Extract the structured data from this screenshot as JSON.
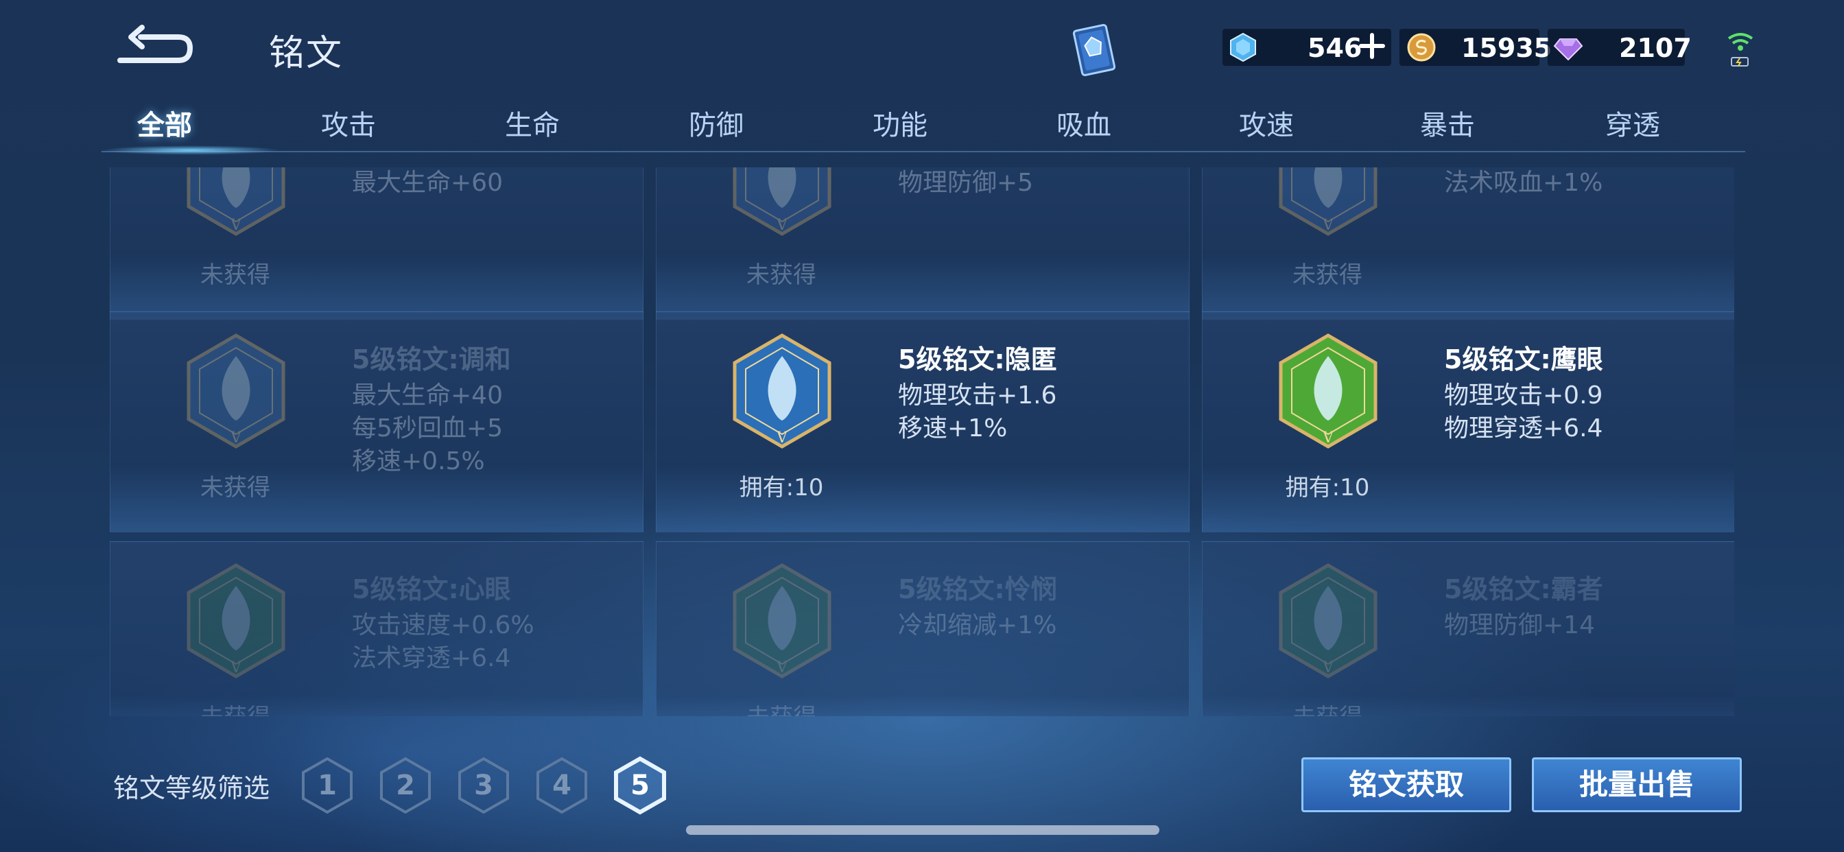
{
  "header": {
    "title": "铭文"
  },
  "resources": {
    "diamond": {
      "value": "546",
      "icon": "diamond-icon",
      "color": "#5ab9f0"
    },
    "gold": {
      "value": "15935",
      "icon": "gold-coin-icon",
      "color": "#e0a84a"
    },
    "gem": {
      "value": "2107",
      "icon": "purple-gem-icon",
      "color": "#b97cf2"
    }
  },
  "tabs": [
    {
      "label": "全部",
      "active": true
    },
    {
      "label": "攻击"
    },
    {
      "label": "生命"
    },
    {
      "label": "防御"
    },
    {
      "label": "功能"
    },
    {
      "label": "吸血"
    },
    {
      "label": "攻速"
    },
    {
      "label": "暴击"
    },
    {
      "label": "穿透"
    }
  ],
  "cards": [
    {
      "name": "",
      "stats": [
        "最大生命+60"
      ],
      "owned": "未获得",
      "state": "dim",
      "color": "#3a6aa8"
    },
    {
      "name": "",
      "stats": [
        "物理防御+5"
      ],
      "owned": "未获得",
      "state": "dim",
      "color": "#3a6aa8"
    },
    {
      "name": "",
      "stats": [
        "法术吸血+1%"
      ],
      "owned": "未获得",
      "state": "dim",
      "color": "#3a6aa8"
    },
    {
      "name": "5级铭文:调和",
      "stats": [
        "最大生命+40",
        "每5秒回血+5",
        "移速+0.5%"
      ],
      "owned": "未获得",
      "state": "dim",
      "color": "#3b6ea8"
    },
    {
      "name": "5级铭文:隐匿",
      "stats": [
        "物理攻击+1.6",
        "移速+1%"
      ],
      "owned": "拥有:10",
      "state": "owned",
      "color": "#2a6fb8"
    },
    {
      "name": "5级铭文:鹰眼",
      "stats": [
        "物理攻击+0.9",
        "物理穿透+6.4"
      ],
      "owned": "拥有:10",
      "state": "owned",
      "color": "#4ea836"
    },
    {
      "name": "5级铭文:心眼",
      "stats": [
        "攻击速度+0.6%",
        "法术穿透+6.4"
      ],
      "owned": "未获得",
      "state": "fade",
      "color": "#3e8a48"
    },
    {
      "name": "5级铭文:怜悯",
      "stats": [
        "冷却缩减+1%"
      ],
      "owned": "未获得",
      "state": "fade",
      "color": "#3e8a48"
    },
    {
      "name": "5级铭文:霸者",
      "stats": [
        "物理防御+14"
      ],
      "owned": "未获得",
      "state": "fade",
      "color": "#3e8a48"
    }
  ],
  "filter": {
    "label": "铭文等级筛选",
    "levels": [
      "1",
      "2",
      "3",
      "4",
      "5"
    ],
    "active_level": "5"
  },
  "actions": {
    "obtain_label": "铭文获取",
    "sell_label": "批量出售"
  }
}
